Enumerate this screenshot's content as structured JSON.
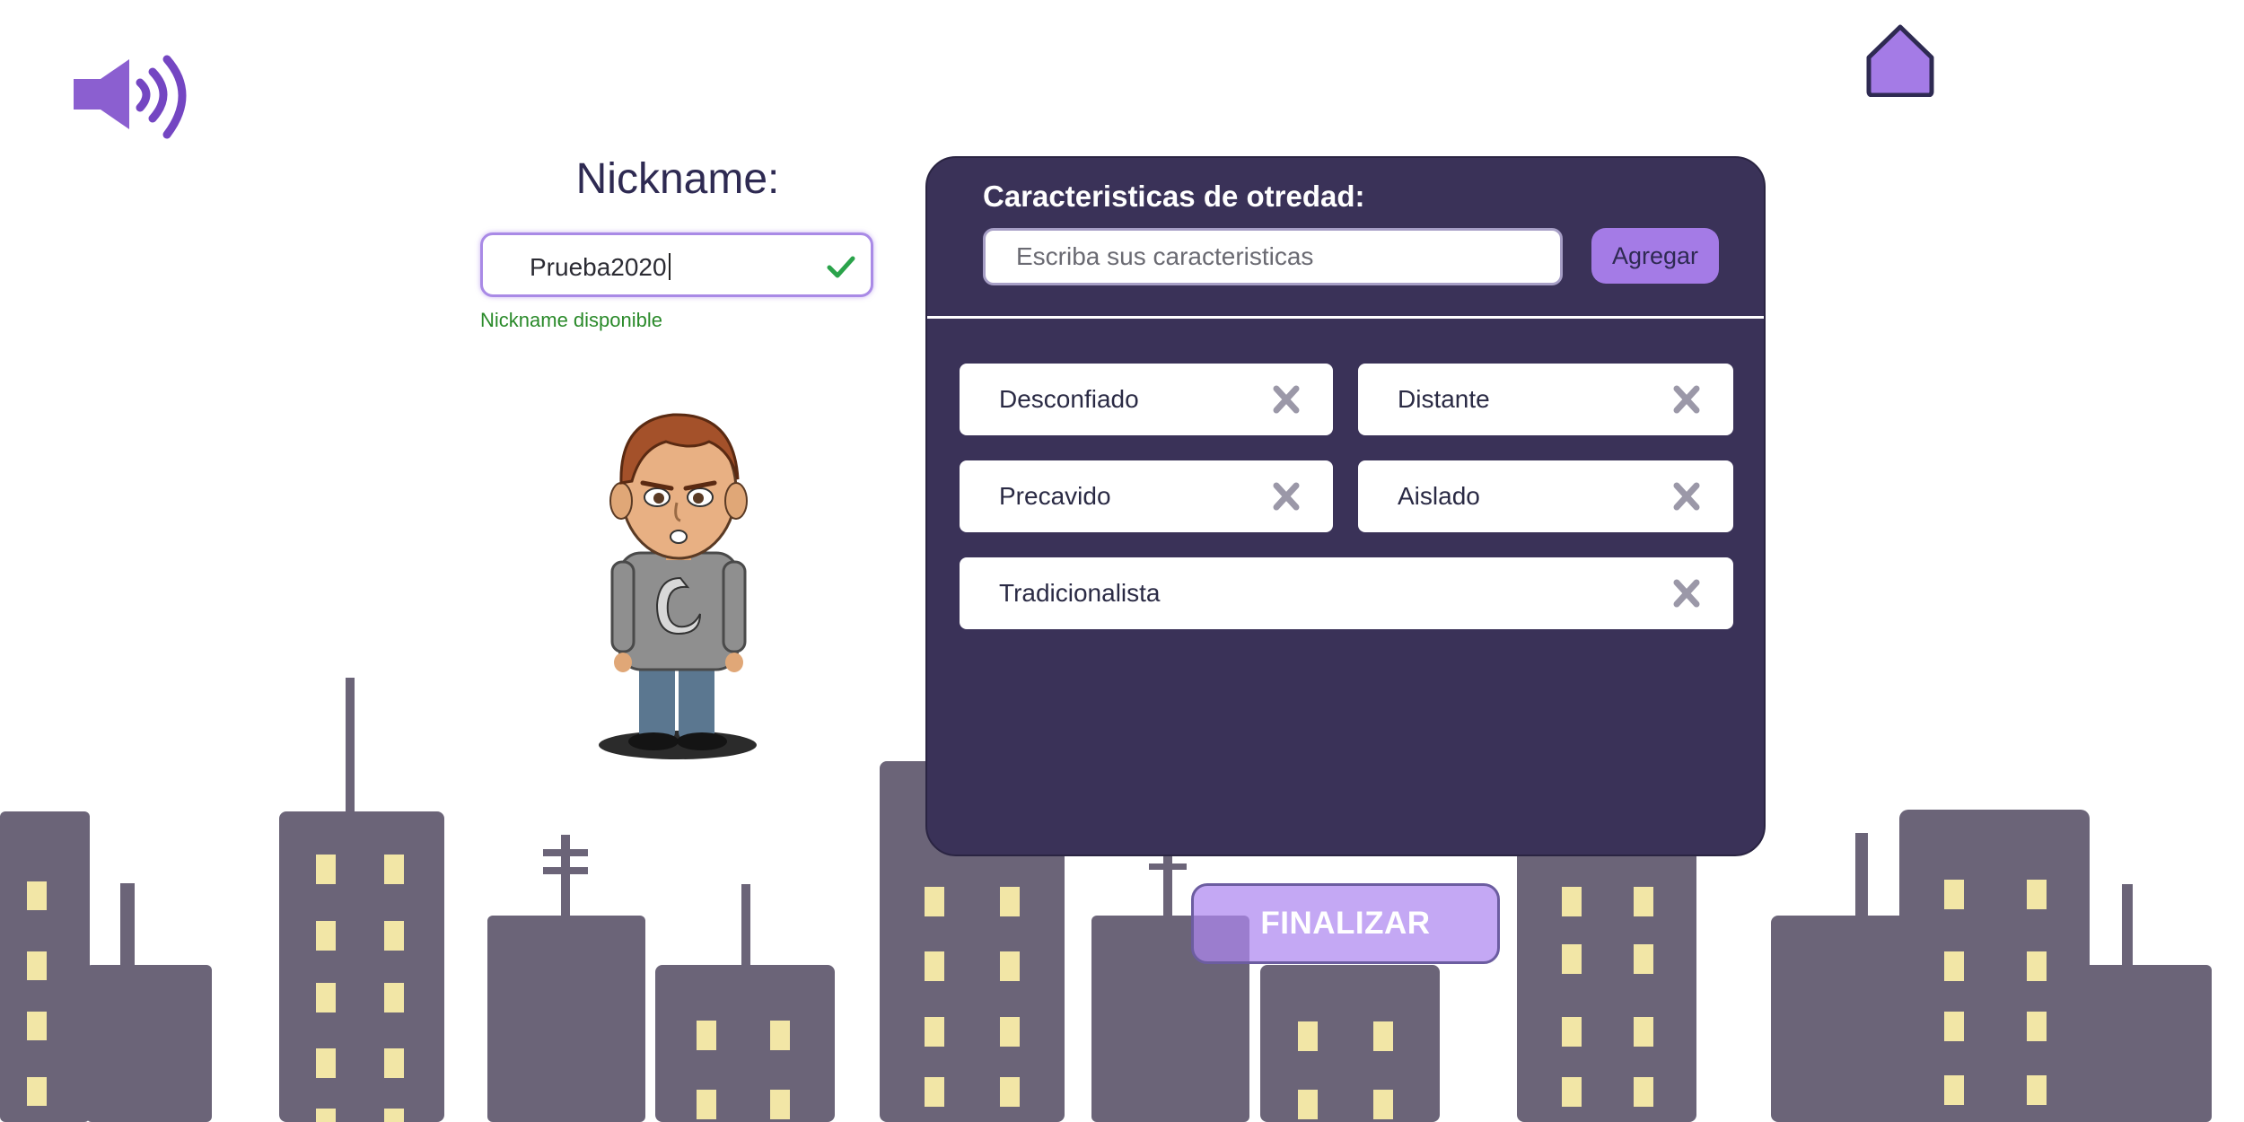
{
  "header": {
    "sound_icon": "speaker-volume-icon",
    "home_icon": "home-icon"
  },
  "nickname": {
    "title": "Nickname:",
    "value": "Prueba2020",
    "status": "Nickname disponible",
    "check_icon": "checkmark-icon",
    "status_color": "#2a8a2a"
  },
  "panel": {
    "title": "Caracteristicas de otredad:",
    "input_placeholder": "Escriba sus caracteristicas",
    "add_label": "Agregar",
    "tags": [
      "Desconfiado",
      "Distante",
      "Precavido",
      "Aislado",
      "Tradicionalista"
    ],
    "remove_icon": "close-x-icon"
  },
  "footer": {
    "finalize_label": "FINALIZAR"
  },
  "colors": {
    "accent": "#a47be6",
    "panel_bg": "#3a3258",
    "buildings": "#6b6478",
    "windows": "#f2e6a6"
  }
}
